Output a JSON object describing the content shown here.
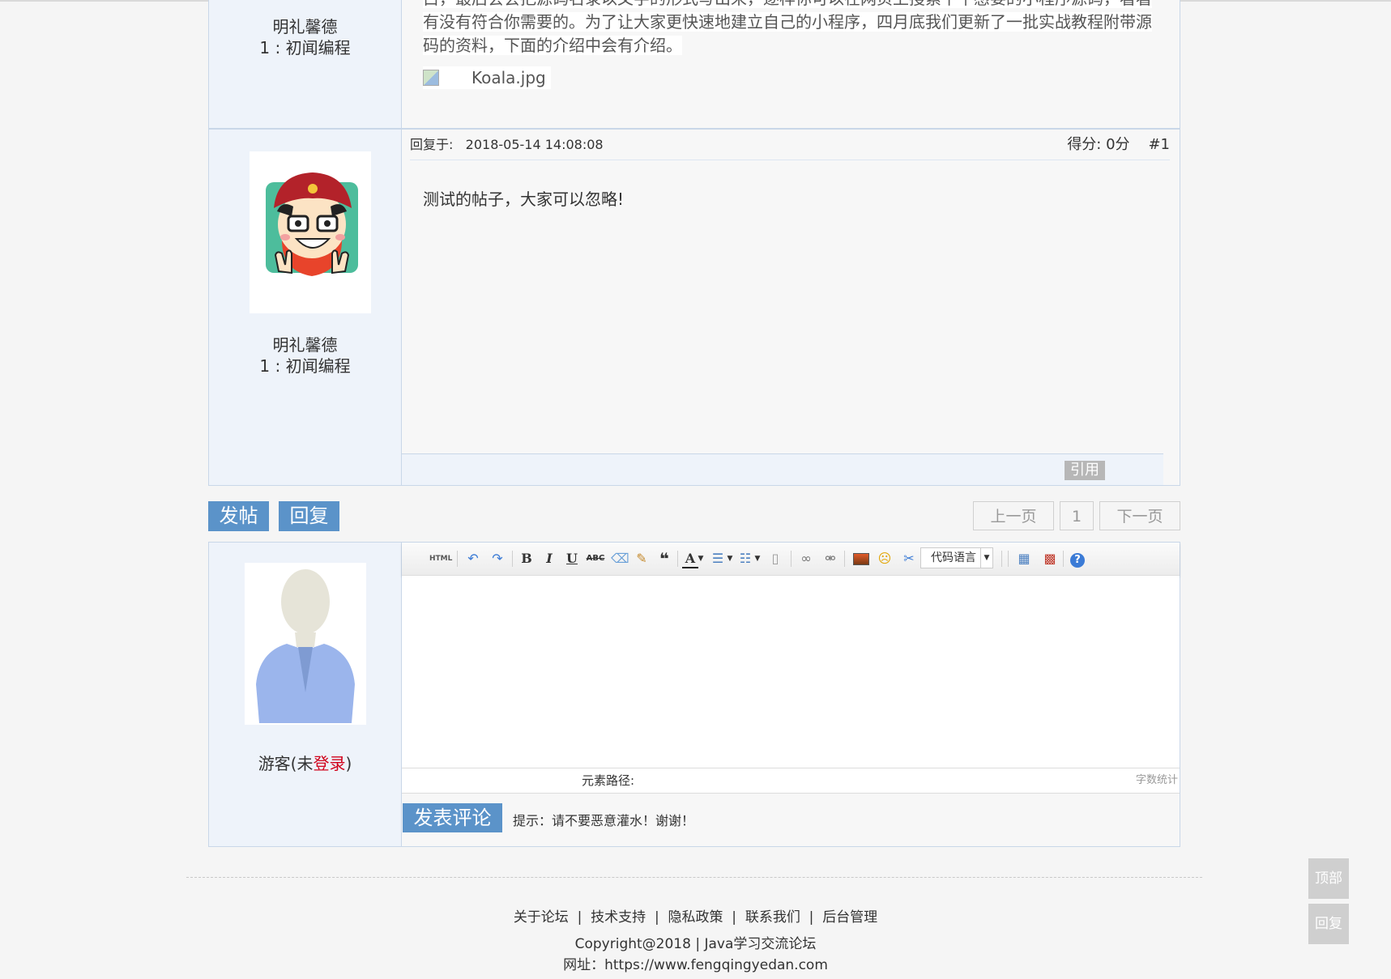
{
  "post0": {
    "username": "明礼馨德",
    "level": "1 : 初闻编程",
    "text_line0": "白，最后会会把源码名录以文字的形式写出来，逐样你可以在网页上搜索下午感要的小程序源码，看看",
    "text_line1": "有没有符合你需要的。为了让大家更快速地建立自己的小程序，四月底我们更新了一批实战教程附带源",
    "text_line2": "码的资料，下面的介绍中会有介绍。",
    "image_alt": "Koala.jpg"
  },
  "reply1": {
    "reply_label": "回复于:",
    "reply_time": "2018-05-14 14:08:08",
    "score": "得分:  0分",
    "floor": "#1",
    "body": "测试的帖子，大家可以忽略!",
    "username": "明礼馨德",
    "level": "1 : 初闻编程",
    "quote_label": "引用"
  },
  "actions": {
    "post_label": "发帖",
    "reply_label": "回复"
  },
  "pagination": {
    "prev": "上一页",
    "current": "1",
    "next": "下一页"
  },
  "editor": {
    "guest_prefix": "游客(未",
    "login_link": "登录",
    "guest_suffix": ")",
    "toolbar": {
      "html": "HTML",
      "bold": "B",
      "italic": "I",
      "underline": "U",
      "strike": "ABC",
      "font_color": "A",
      "code_lang": "代码语言"
    },
    "element_path_label": "元素路径:",
    "word_count_label": "字数统计",
    "submit_label": "发表评论",
    "hint": "提示：请不要恶意灌水！谢谢！"
  },
  "footer": {
    "links": [
      "关于论坛",
      "技术支持",
      "隐私政策",
      "联系我们",
      "后台管理"
    ],
    "copyright": "Copyright@2018 | Java学习交流论坛",
    "website": "网址：https://www.fengqingyedan.com"
  },
  "side": {
    "top_label": "顶部",
    "reply_label": "回复"
  },
  "colors": {
    "accent": "#5b93c9",
    "login_red": "#d0021b"
  }
}
